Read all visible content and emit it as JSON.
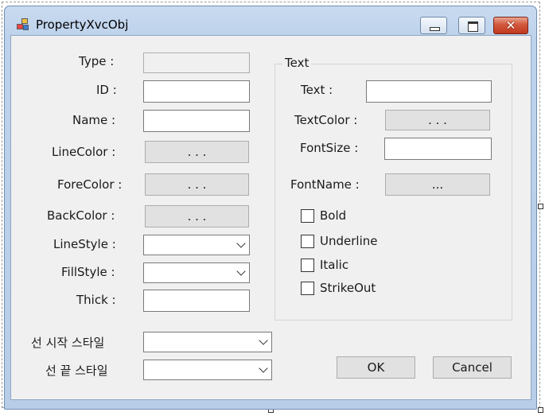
{
  "window": {
    "title": "PropertyXvcObj",
    "close_glyph": "✕"
  },
  "icons": {
    "app": "app-form-icon",
    "minimize": "minimize-icon",
    "maximize": "maximize-icon",
    "close": "close-icon",
    "dropdown": "chevron-down-icon"
  },
  "left": {
    "type_label": "Type :",
    "type_value": "",
    "id_label": "ID :",
    "id_value": "",
    "name_label": "Name :",
    "name_value": "",
    "linecolor_label": "LineColor :",
    "linecolor_button": ". . .",
    "forecolor_label": "ForeColor :",
    "forecolor_button": ". . .",
    "backcolor_label": "BackColor :",
    "backcolor_button": ". . .",
    "linestyle_label": "LineStyle :",
    "linestyle_value": "",
    "fillstyle_label": "FillStyle :",
    "fillstyle_value": "",
    "thick_label": "Thick :",
    "thick_value": "",
    "line_start_label": "선 시작 스타일",
    "line_start_value": "",
    "line_end_label": "선 끝 스타일",
    "line_end_value": ""
  },
  "text_group": {
    "title": "Text",
    "text_label": "Text :",
    "text_value": "",
    "textcolor_label": "TextColor :",
    "textcolor_button": ". . .",
    "fontsize_label": "FontSize :",
    "fontsize_value": "",
    "fontname_label": "FontName :",
    "fontname_button": "...",
    "bold_label": "Bold",
    "bold_checked": false,
    "underline_label": "Underline",
    "underline_checked": false,
    "italic_label": "Italic",
    "italic_checked": false,
    "strikeout_label": "StrikeOut",
    "strikeout_checked": false
  },
  "buttons": {
    "ok": "OK",
    "cancel": "Cancel"
  }
}
